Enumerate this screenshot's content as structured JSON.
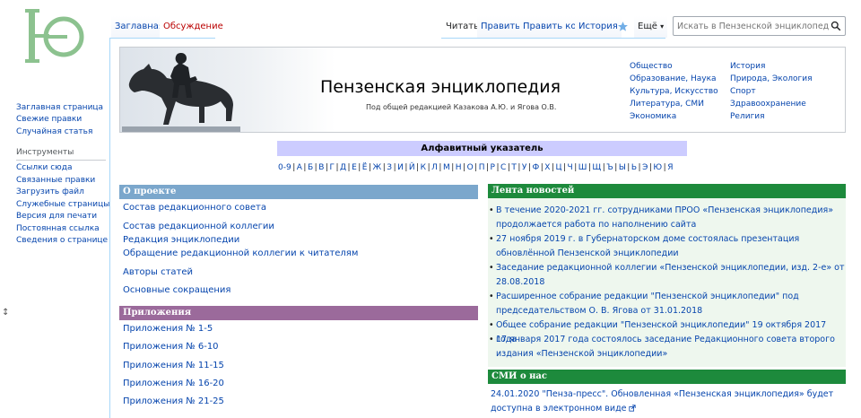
{
  "logo_icon": "encyclopedia-logo-icon",
  "sidebar": {
    "main_links": [
      "Заглавная страница",
      "Свежие правки",
      "Случайная статья"
    ],
    "tools_heading": "Инструменты",
    "tools_links": [
      "Ссылки сюда",
      "Связанные правки",
      "Загрузить файл",
      "Служебные страницы",
      "Версия для печати",
      "Постоянная ссылка",
      "Сведения о странице"
    ]
  },
  "tabs": {
    "left": [
      {
        "label": "Заглавная"
      },
      {
        "label": "Обсуждение"
      }
    ],
    "right": [
      {
        "label": "Читать"
      },
      {
        "label": "Править"
      },
      {
        "label": "Править код"
      },
      {
        "label": "История"
      }
    ],
    "more_label": "Ещё"
  },
  "search": {
    "placeholder": "Искать в Пензенской энциклопедии"
  },
  "banner": {
    "title": "Пензенская энциклопедия",
    "subtitle": "Под общей редакцией Казакова А.Ю. и Ягова О.В.",
    "links_col1": [
      "Общество",
      "Образование, Наука",
      "Культура, Искусство",
      "Литература, СМИ",
      "Экономика"
    ],
    "links_col2": [
      "История",
      "Природа, Экология",
      "Спорт",
      "Здравоохранение",
      "Религия"
    ]
  },
  "alphabet": {
    "title": "Алфавитный указатель",
    "letters": [
      "0-9",
      "А",
      "Б",
      "В",
      "Г",
      "Д",
      "Е",
      "Ё",
      "Ж",
      "З",
      "И",
      "Й",
      "К",
      "Л",
      "М",
      "Н",
      "О",
      "П",
      "Р",
      "С",
      "Т",
      "У",
      "Ф",
      "Х",
      "Ц",
      "Ч",
      "Ш",
      "Щ",
      "Ъ",
      "Ы",
      "Ь",
      "Э",
      "Ю",
      "Я"
    ]
  },
  "about": {
    "title": "О проекте",
    "links": [
      "Состав редакционного совета",
      "Состав редакционной коллегии",
      "Редакция энциклопедии",
      "Обращение редакционной коллегии к читателям",
      "Авторы статей",
      "Основные сокращения"
    ]
  },
  "appendices": {
    "title": "Приложения",
    "links": [
      "Приложения № 1-5",
      "Приложения № 6-10",
      "Приложения № 11-15",
      "Приложения № 16-20",
      "Приложения № 21-25"
    ]
  },
  "news": {
    "title": "Лента новостей",
    "items": [
      "В течение 2020-2021 гг. сотрудниками ПРОО «Пензенская энциклопедия» продолжается работа по наполнению сайта",
      "27 ноября 2019 г. в Губернаторском доме состоялась презентация обновлённой Пензенской энциклопедии",
      "Заседание редакционной коллегии «Пензенской энциклопедии, изд. 2-е» от 28.08.2018",
      "Расширенное собрание редакции \"Пензенской энциклопедии\" под председательством О. В. Ягова от 31.01.2018",
      "Общее собрание редакции \"Пензенской энциклопедии\" 19 октября 2017 года",
      "17 января 2017 года состоялось заседание Редакционного совета второго издания «Пензенской энциклопедии»"
    ]
  },
  "media": {
    "title": "СМИ о нас",
    "text": "24.01.2020 \"Пенза-пресс\". Обновленная «Пензенская энциклопедия» будет доступна в электронном виде"
  },
  "colors": {
    "about_head": "#7ba7cc",
    "appendices_head": "#9b6a9b",
    "news_head": "#1d8a3c",
    "media_head": "#1d8a3c",
    "alpha_head": "#ccccff",
    "link": "#0645ad"
  }
}
